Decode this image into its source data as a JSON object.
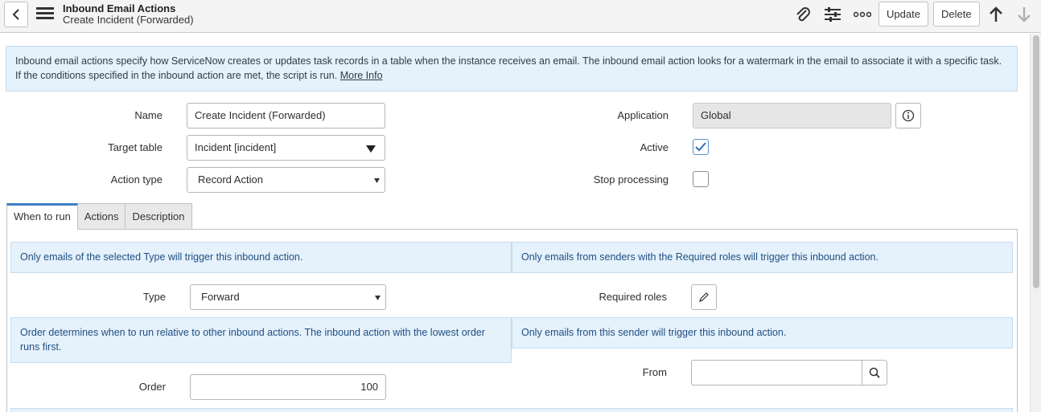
{
  "header": {
    "title": "Inbound Email Actions",
    "subtitle": "Create Incident (Forwarded)",
    "update_label": "Update",
    "delete_label": "Delete"
  },
  "info": {
    "text": "Inbound email actions specify how ServiceNow creates or updates task records in a table when the instance receives an email. The inbound email action looks for a watermark in the email to associate it with a specific task. If the conditions specified in the inbound action are met, the script is run.",
    "link": "More Info"
  },
  "form": {
    "name_label": "Name",
    "name_value": "Create Incident (Forwarded)",
    "target_table_label": "Target table",
    "target_table_value": "Incident [incident]",
    "action_type_label": "Action type",
    "action_type_value": "Record Action",
    "application_label": "Application",
    "application_value": "Global",
    "active_label": "Active",
    "active_checked": true,
    "stop_processing_label": "Stop processing",
    "stop_processing_checked": false
  },
  "tabs": [
    {
      "label": "When to run",
      "active": true
    },
    {
      "label": "Actions",
      "active": false
    },
    {
      "label": "Description",
      "active": false
    }
  ],
  "when_to_run": {
    "type_note": "Only emails of the selected Type will trigger this inbound action.",
    "roles_note": "Only emails from senders with the Required roles will trigger this inbound action.",
    "type_label": "Type",
    "type_value": "Forward",
    "required_roles_label": "Required roles",
    "order_note": "Order determines when to run relative to other inbound actions. The inbound action with the lowest order runs first.",
    "from_note": "Only emails from this sender will trigger this inbound action.",
    "order_label": "Order",
    "order_value": "100",
    "from_label": "From",
    "from_value": ""
  },
  "colors": {
    "accent": "#3d7fc5",
    "info_bg": "#e5f1fb",
    "header_bg": "#f4f4f4"
  }
}
